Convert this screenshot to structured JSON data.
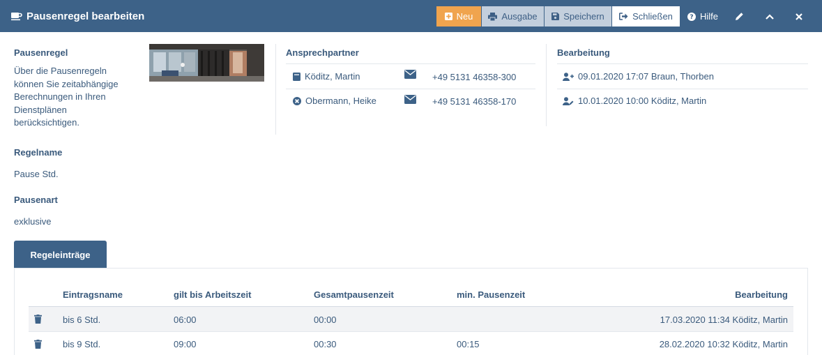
{
  "window": {
    "title": "Pausenregel bearbeiten",
    "title_icon": "coffee-icon"
  },
  "toolbar": {
    "neu": "Neu",
    "ausgabe": "Ausgabe",
    "speichern": "Speichern",
    "schliessen": "Schließen",
    "hilfe": "Hilfe",
    "colors": {
      "neu": "#f0a44e",
      "secondary": "#c3cfdd",
      "bar": "#3d6288"
    }
  },
  "info": {
    "heading": "Pausenregel",
    "description_lines": [
      "Über die Pausenregeln",
      "können Sie zeitabhängige",
      "Berechnungen in Ihren",
      "Dienstplänen",
      "berücksichtigen."
    ]
  },
  "contacts": {
    "heading": "Ansprechpartner",
    "items": [
      {
        "name": "Köditz, Martin",
        "icon": "book-icon",
        "phone": "+49 5131 46358-300"
      },
      {
        "name": "Obermann, Heike",
        "icon": "x-circle-icon",
        "phone": "+49 5131 46358-170"
      }
    ]
  },
  "edits": {
    "heading": "Bearbeitung",
    "items": [
      {
        "text": "09.01.2020 17:07 Braun, Thorben",
        "icon": "user-plus-icon"
      },
      {
        "text": "10.01.2020 10:00 Köditz, Martin",
        "icon": "user-edit-icon"
      }
    ]
  },
  "fields": {
    "regelname_label": "Regelname",
    "regelname_value": "Pause Std.",
    "pausenart_label": "Pausenart",
    "pausenart_value": "exklusive"
  },
  "tabs": {
    "active": "Regeleinträge"
  },
  "table": {
    "columns": [
      "Eintragsname",
      "gilt bis Arbeitszeit",
      "Gesamtpausenzeit",
      "min. Pausenzeit",
      "Bearbeitung"
    ],
    "rows": [
      {
        "name": "bis 6 Std.",
        "gilt_bis": "06:00",
        "gesamt": "00:00",
        "min": "",
        "bearbeitung": "17.03.2020 11:34 Köditz, Martin"
      },
      {
        "name": "bis 9 Std.",
        "gilt_bis": "09:00",
        "gesamt": "00:30",
        "min": "00:15",
        "bearbeitung": "28.02.2020 10:32 Köditz, Martin"
      }
    ]
  }
}
